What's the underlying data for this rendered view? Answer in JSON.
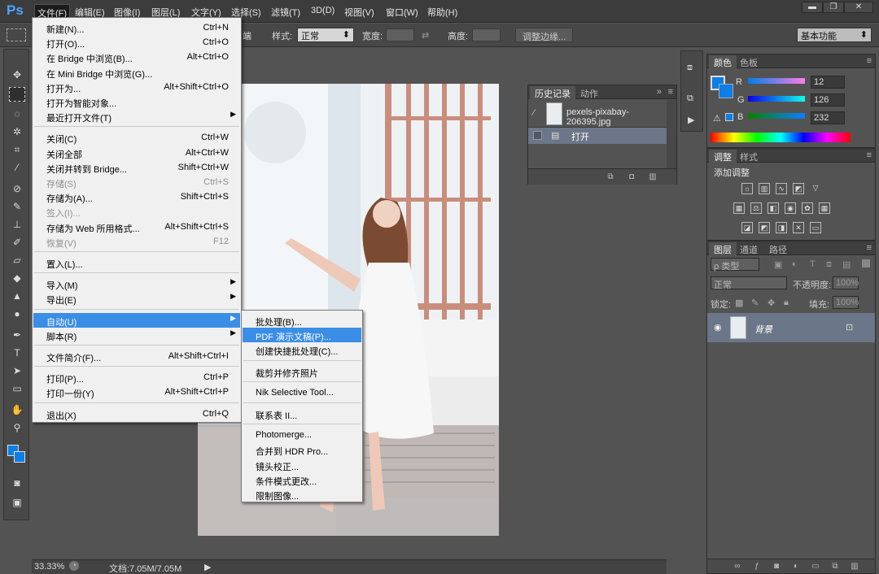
{
  "app": {
    "logo": "Ps"
  },
  "menubar": {
    "items": [
      "文件(F)",
      "编辑(E)",
      "图像(I)",
      "图层(L)",
      "文字(Y)",
      "选择(S)",
      "滤镜(T)",
      "3D(D)",
      "视图(V)",
      "窗口(W)",
      "帮助(H)"
    ],
    "window_buttons": [
      "▬",
      "❐",
      "✕"
    ]
  },
  "options": {
    "partial_label": "端",
    "style_label": "样式:",
    "style_value": "正常",
    "width_label": "宽度:",
    "height_label": "高度:",
    "refine_button": "调整边缘...",
    "workspace": "基本功能"
  },
  "file_menu": {
    "items": [
      {
        "label": "新建(N)...",
        "shortcut": "Ctrl+N"
      },
      {
        "label": "打开(O)...",
        "shortcut": "Ctrl+O"
      },
      {
        "label": "在 Bridge 中浏览(B)...",
        "shortcut": "Alt+Ctrl+O"
      },
      {
        "label": "在 Mini Bridge 中浏览(G)...",
        "shortcut": ""
      },
      {
        "label": "打开为...",
        "shortcut": "Alt+Shift+Ctrl+O"
      },
      {
        "label": "打开为智能对象...",
        "shortcut": ""
      },
      {
        "label": "最近打开文件(T)",
        "shortcut": "",
        "submenu": true
      },
      {
        "sep": true
      },
      {
        "label": "关闭(C)",
        "shortcut": "Ctrl+W"
      },
      {
        "label": "关闭全部",
        "shortcut": "Alt+Ctrl+W"
      },
      {
        "label": "关闭并转到 Bridge...",
        "shortcut": "Shift+Ctrl+W"
      },
      {
        "label": "存储(S)",
        "shortcut": "Ctrl+S",
        "disabled": true
      },
      {
        "label": "存储为(A)...",
        "shortcut": "Shift+Ctrl+S"
      },
      {
        "label": "签入(I)...",
        "shortcut": "",
        "disabled": true
      },
      {
        "label": "存储为 Web 所用格式...",
        "shortcut": "Alt+Shift+Ctrl+S"
      },
      {
        "label": "恢复(V)",
        "shortcut": "F12",
        "disabled": true
      },
      {
        "sep": true
      },
      {
        "label": "置入(L)...",
        "shortcut": ""
      },
      {
        "sep": true
      },
      {
        "label": "导入(M)",
        "shortcut": "",
        "submenu": true
      },
      {
        "label": "导出(E)",
        "shortcut": "",
        "submenu": true
      },
      {
        "sep": true
      },
      {
        "label": "自动(U)",
        "shortcut": "",
        "submenu": true,
        "highlighted": true
      },
      {
        "label": "脚本(R)",
        "shortcut": "",
        "submenu": true
      },
      {
        "sep": true
      },
      {
        "label": "文件简介(F)...",
        "shortcut": "Alt+Shift+Ctrl+I"
      },
      {
        "sep": true
      },
      {
        "label": "打印(P)...",
        "shortcut": "Ctrl+P"
      },
      {
        "label": "打印一份(Y)",
        "shortcut": "Alt+Shift+Ctrl+P"
      },
      {
        "sep": true
      },
      {
        "label": "退出(X)",
        "shortcut": "Ctrl+Q"
      }
    ]
  },
  "auto_submenu": {
    "items": [
      {
        "label": "批处理(B)..."
      },
      {
        "label": "PDF 演示文稿(P)...",
        "highlighted": true
      },
      {
        "label": "创建快捷批处理(C)..."
      },
      {
        "sep": true
      },
      {
        "label": "裁剪并修齐照片"
      },
      {
        "sep": true
      },
      {
        "label": "Nik Selective Tool..."
      },
      {
        "sep": true
      },
      {
        "label": "联系表 II..."
      },
      {
        "sep": true
      },
      {
        "label": "Photomerge..."
      },
      {
        "label": "合并到 HDR Pro..."
      },
      {
        "label": "镜头校正..."
      },
      {
        "label": "条件模式更改..."
      },
      {
        "label": "限制图像..."
      }
    ]
  },
  "history": {
    "tabs": [
      "历史记录",
      "动作"
    ],
    "snapshot": "pexels-pixabay-206395.jpg",
    "steps": [
      "打开"
    ]
  },
  "color": {
    "tabs": [
      "颜色",
      "色板"
    ],
    "channels": [
      {
        "name": "R",
        "value": "12"
      },
      {
        "name": "G",
        "value": "126"
      },
      {
        "name": "B",
        "value": "232"
      }
    ],
    "swatch": "#0c7ee8"
  },
  "adjustments": {
    "tabs": [
      "调整",
      "样式"
    ],
    "title": "添加调整"
  },
  "layers": {
    "tabs": [
      "图层",
      "通道",
      "路径"
    ],
    "kind": "ρ 类型",
    "blend": "正常",
    "opacity_label": "不透明度:",
    "opacity": "100%",
    "lock_label": "锁定:",
    "fill_label": "填充:",
    "fill": "100%",
    "layer_name": "背景"
  },
  "status": {
    "zoom": "33.33%",
    "doc": "文档:7.05M/7.05M"
  }
}
